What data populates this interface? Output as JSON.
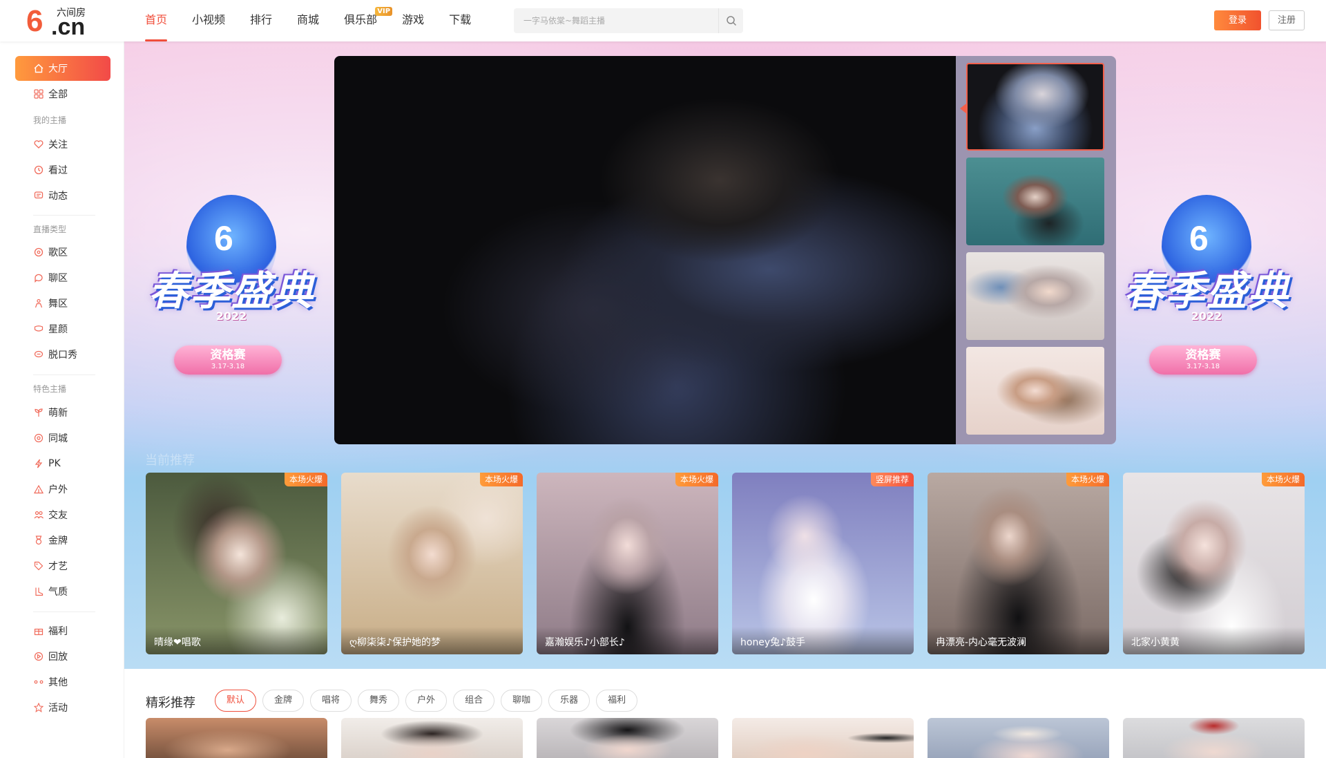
{
  "header": {
    "logo_name": "六间房",
    "logo_six": "6",
    "logo_cn": ".cn",
    "nav": [
      {
        "label": "首页",
        "active": true
      },
      {
        "label": "小视频"
      },
      {
        "label": "排行"
      },
      {
        "label": "商城"
      },
      {
        "label": "俱乐部",
        "badge": "VIP"
      },
      {
        "label": "游戏"
      },
      {
        "label": "下载"
      }
    ],
    "search_placeholder": "一字马依棠~舞蹈主播",
    "login_label": "登录",
    "register_label": "注册"
  },
  "sidebar": {
    "items": [
      {
        "label": "大厅",
        "icon": "home-icon",
        "active": true
      },
      {
        "label": "全部",
        "icon": "grid-icon"
      },
      {
        "label": "关注",
        "icon": "heart-icon"
      },
      {
        "label": "看过",
        "icon": "clock-icon"
      },
      {
        "label": "动态",
        "icon": "message-icon"
      },
      {
        "label": "歌区",
        "icon": "disc-icon"
      },
      {
        "label": "聊区",
        "icon": "chat-icon"
      },
      {
        "label": "舞区",
        "icon": "dancer-icon"
      },
      {
        "label": "星颜",
        "icon": "mask-icon"
      },
      {
        "label": "脱口秀",
        "icon": "speech-icon"
      },
      {
        "label": "萌新",
        "icon": "sprout-icon"
      },
      {
        "label": "同城",
        "icon": "location-icon"
      },
      {
        "label": "PK",
        "icon": "lightning-icon"
      },
      {
        "label": "户外",
        "icon": "tent-icon"
      },
      {
        "label": "交友",
        "icon": "users-icon"
      },
      {
        "label": "金牌",
        "icon": "medal-icon"
      },
      {
        "label": "才艺",
        "icon": "tag-icon"
      },
      {
        "label": "气质",
        "icon": "boot-icon"
      },
      {
        "label": "福利",
        "icon": "gift-icon"
      },
      {
        "label": "回放",
        "icon": "replay-icon"
      },
      {
        "label": "其他",
        "icon": "dots-icon"
      },
      {
        "label": "活动",
        "icon": "star-icon"
      }
    ],
    "categories": {
      "my_hosts": "我的主播",
      "live_types": "直播类型",
      "featured_hosts": "特色主播"
    }
  },
  "banner": {
    "event_title": "春季盛典",
    "event_year": "2022",
    "event_six": "6",
    "qualifier_label": "资格赛",
    "qualifier_dates": "3.17-3.18",
    "section_faint": "当前推荐",
    "cards": [
      {
        "name": "晴缘❤唱歌",
        "tag": "本场火爆"
      },
      {
        "name": "ღ柳柒柒♪保护她的梦",
        "tag": "本场火爆"
      },
      {
        "name": "嘉瀚娱乐♪小部长♪",
        "tag": "本场火爆"
      },
      {
        "name": "honey兔♪鼓手",
        "tag": "竖屏推荐"
      },
      {
        "name": "冉漂亮-内心毫无波澜",
        "tag": "本场火爆"
      },
      {
        "name": "北家小黄黄",
        "tag": "本场火爆"
      }
    ]
  },
  "featured": {
    "title": "精彩推荐",
    "filters": [
      "默认",
      "金牌",
      "唱将",
      "舞秀",
      "户外",
      "组合",
      "聊咖",
      "乐器",
      "福利"
    ],
    "active_filter": "默认"
  },
  "colors": {
    "accent": "#f04e3b",
    "login_gradient_start": "#ff8a3d",
    "login_gradient_end": "#f1522e",
    "hot_tag": "#f46a2a"
  }
}
